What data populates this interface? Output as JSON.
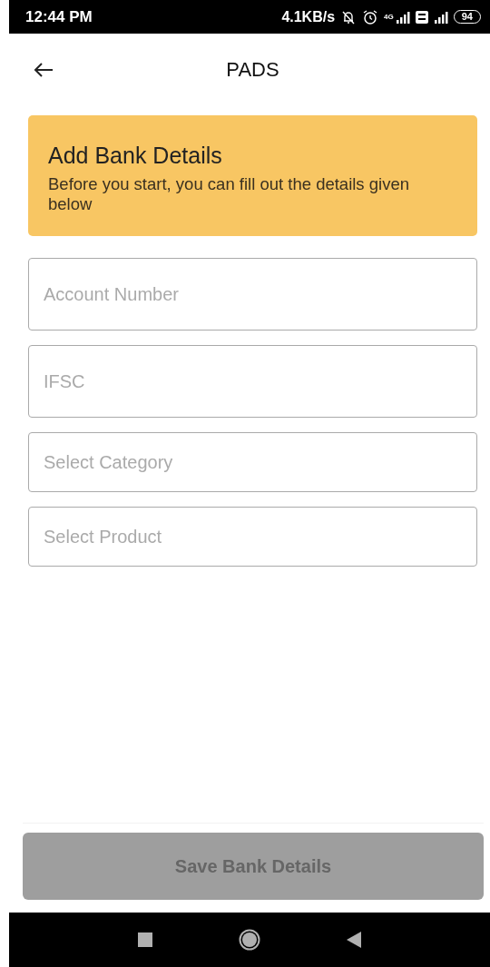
{
  "status_bar": {
    "time": "12:44 PM",
    "speed": "4.1KB/s",
    "network": "4G",
    "battery": "94"
  },
  "app_bar": {
    "title": "PADS"
  },
  "banner": {
    "title": "Add Bank Details",
    "text": "Before you start, you can fill out the details given below"
  },
  "fields": [
    {
      "kind": "input",
      "placeholder": "Account Number"
    },
    {
      "kind": "input",
      "placeholder": "IFSC"
    },
    {
      "kind": "select",
      "placeholder": "Select Category"
    },
    {
      "kind": "select",
      "placeholder": "Select Product"
    }
  ],
  "save_button": {
    "label": "Save Bank Details",
    "disabled": true
  }
}
